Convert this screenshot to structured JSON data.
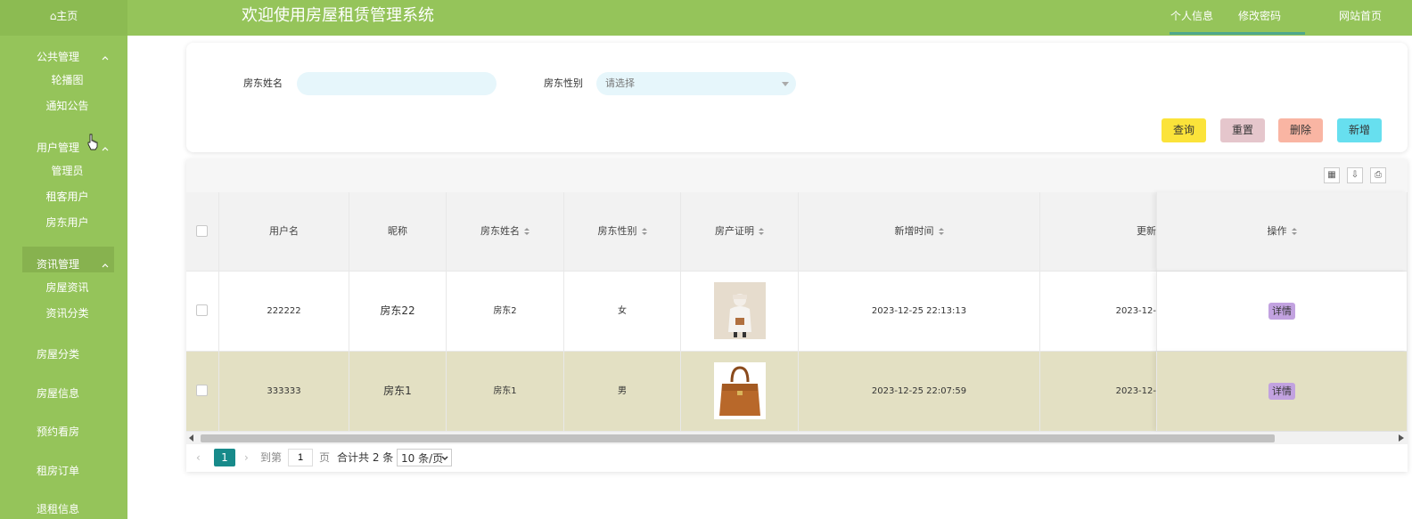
{
  "header": {
    "home": "⌂主页",
    "title": "欢迎使用房屋租赁管理系统",
    "links": [
      "个人信息",
      "修改密码",
      "网站首页"
    ]
  },
  "sidebar": {
    "groups": [
      {
        "title": "公共管理",
        "items": [
          "轮播图",
          "通知公告"
        ]
      },
      {
        "title": "用户管理",
        "items": [
          "管理员",
          "租客用户",
          "房东用户"
        ]
      },
      {
        "title": "资讯管理",
        "items": [
          "房屋资讯",
          "资讯分类"
        ]
      }
    ],
    "singles": [
      "房屋分类",
      "房屋信息",
      "预约看房",
      "租房订单",
      "退租信息"
    ],
    "active": "房东用户"
  },
  "search": {
    "name_label": "房东姓名",
    "name_value": "",
    "gender_label": "房东性别",
    "gender_placeholder": "请选择",
    "buttons": {
      "query": "查询",
      "reset": "重置",
      "delete": "删除",
      "add": "新增"
    },
    "button_colors": {
      "query": "#fbe33a",
      "reset": "#e5c6cc",
      "delete": "#f9b5a3",
      "add": "#67dfef"
    }
  },
  "table": {
    "columns": [
      "用户名",
      "昵称",
      "房东姓名",
      "房东性别",
      "房产证明",
      "新增时间",
      "更新",
      "操作"
    ],
    "rows": [
      {
        "username": "222222",
        "nickname": "房东22",
        "name": "房东2",
        "gender": "女",
        "proof_icon": "person-photo",
        "created": "2023-12-25 22:13:13",
        "updated": "2023-12-",
        "action": "详情"
      },
      {
        "username": "333333",
        "nickname": "房东1",
        "name": "房东1",
        "gender": "男",
        "proof_icon": "handbag-photo",
        "created": "2023-12-25 22:07:59",
        "updated": "2023-12-",
        "action": "详情"
      }
    ],
    "highlight_color": "#e3e0c3"
  },
  "pagination": {
    "prev": "‹",
    "current": "1",
    "next": "›",
    "goto_label": "到第",
    "goto_value": "1",
    "page_unit": "页",
    "total": "合计共 2 条",
    "page_size": "10 条/页"
  }
}
